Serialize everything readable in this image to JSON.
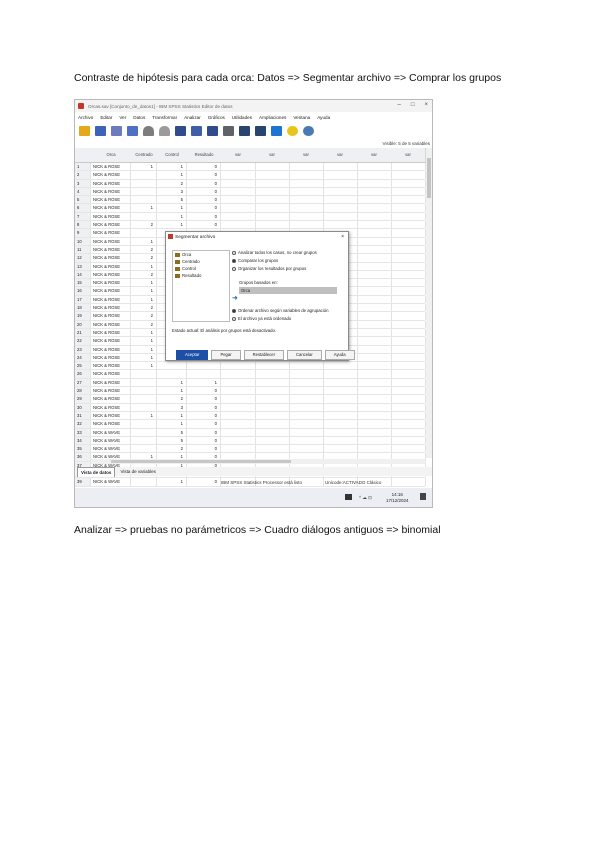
{
  "captions": {
    "top": "Contraste de hipótesis para cada orca: Datos => Segmentar archivo => Comprar los grupos",
    "bottom": "Analizar => pruebas no parámetricos => Cuadro diálogos antiguos => binomial"
  },
  "screenshot": {
    "window_title": "Orcas.sav [Conjunto_de_datos1] - IBM SPSS Statistics Editor de datos",
    "window_controls": [
      "–",
      "□",
      "×"
    ],
    "menu": [
      "Archivo",
      "Editar",
      "Ver",
      "Datos",
      "Transformar",
      "Analizar",
      "Gráficos",
      "Utilidades",
      "Ampliaciones",
      "Ventana",
      "Ayuda"
    ],
    "toolbar_icons": [
      "folder-icon",
      "save-icon",
      "print-icon",
      "dialog-recall-icon",
      "undo-icon",
      "redo-icon",
      "goto-variable-icon",
      "variables-icon",
      "find-icon",
      "split-file-icon",
      "select-cases-icon",
      "value-labels-icon",
      "extension-icon",
      "search-icon"
    ],
    "visible_label": "Visible: 5 de 5 variables",
    "columns": [
      "Orca",
      "Centrado",
      "Control",
      "Resultado",
      "var",
      "var",
      "var",
      "var",
      "var",
      "var"
    ],
    "rows": [
      {
        "n": "1",
        "orca": "NICK & ROSE",
        "cent": "1",
        "ctr": "1",
        "res": "0"
      },
      {
        "n": "2",
        "orca": "NICK & ROSE",
        "cent": "",
        "ctr": "1",
        "res": "0"
      },
      {
        "n": "3",
        "orca": "NICK & ROSE",
        "cent": "",
        "ctr": "2",
        "res": "0"
      },
      {
        "n": "4",
        "orca": "NICK & ROSE",
        "cent": "",
        "ctr": "3",
        "res": "0"
      },
      {
        "n": "5",
        "orca": "NICK & ROSE",
        "cent": "",
        "ctr": "5",
        "res": "0"
      },
      {
        "n": "6",
        "orca": "NICK & ROSE",
        "cent": "1",
        "ctr": "1",
        "res": "0"
      },
      {
        "n": "7",
        "orca": "NICK & ROSE",
        "cent": "",
        "ctr": "1",
        "res": "0"
      },
      {
        "n": "8",
        "orca": "NICK & ROSE",
        "cent": "2",
        "ctr": "1",
        "res": "0"
      },
      {
        "n": "9",
        "orca": "NICK & ROSE",
        "cent": "",
        "ctr": "1",
        "res": "0"
      },
      {
        "n": "10",
        "orca": "NICK & ROSE",
        "cent": "1",
        "ctr": "",
        "res": ""
      },
      {
        "n": "11",
        "orca": "NICK & ROSE",
        "cent": "2",
        "ctr": "",
        "res": ""
      },
      {
        "n": "12",
        "orca": "NICK & ROSE",
        "cent": "2",
        "ctr": "",
        "res": ""
      },
      {
        "n": "13",
        "orca": "NICK & ROSE",
        "cent": "1",
        "ctr": "",
        "res": ""
      },
      {
        "n": "14",
        "orca": "NICK & ROSE",
        "cent": "2",
        "ctr": "",
        "res": ""
      },
      {
        "n": "15",
        "orca": "NICK & ROSE",
        "cent": "1",
        "ctr": "",
        "res": ""
      },
      {
        "n": "16",
        "orca": "NICK & ROSE",
        "cent": "1",
        "ctr": "",
        "res": ""
      },
      {
        "n": "17",
        "orca": "NICK & ROSE",
        "cent": "1",
        "ctr": "",
        "res": ""
      },
      {
        "n": "18",
        "orca": "NICK & ROSE",
        "cent": "2",
        "ctr": "",
        "res": ""
      },
      {
        "n": "19",
        "orca": "NICK & ROSE",
        "cent": "2",
        "ctr": "",
        "res": ""
      },
      {
        "n": "20",
        "orca": "NICK & ROSE",
        "cent": "2",
        "ctr": "",
        "res": ""
      },
      {
        "n": "21",
        "orca": "NICK & ROSE",
        "cent": "1",
        "ctr": "",
        "res": ""
      },
      {
        "n": "22",
        "orca": "NICK & ROSE",
        "cent": "1",
        "ctr": "",
        "res": ""
      },
      {
        "n": "23",
        "orca": "NICK & ROSE",
        "cent": "1",
        "ctr": "",
        "res": ""
      },
      {
        "n": "24",
        "orca": "NICK & ROSE",
        "cent": "1",
        "ctr": "",
        "res": ""
      },
      {
        "n": "25",
        "orca": "NICK & ROSE",
        "cent": "1",
        "ctr": "",
        "res": ""
      },
      {
        "n": "26",
        "orca": "NICK & ROSE",
        "cent": "",
        "ctr": "",
        "res": ""
      },
      {
        "n": "27",
        "orca": "NICK & ROSE",
        "cent": "",
        "ctr": "1",
        "res": "1"
      },
      {
        "n": "28",
        "orca": "NICK & ROSE",
        "cent": "",
        "ctr": "1",
        "res": "0"
      },
      {
        "n": "29",
        "orca": "NICK & ROSE",
        "cent": "",
        "ctr": "2",
        "res": "0"
      },
      {
        "n": "30",
        "orca": "NICK & ROSE",
        "cent": "",
        "ctr": "3",
        "res": "0"
      },
      {
        "n": "31",
        "orca": "NICK & ROSE",
        "cent": "1",
        "ctr": "1",
        "res": "0"
      },
      {
        "n": "32",
        "orca": "NICK & ROSE",
        "cent": "",
        "ctr": "1",
        "res": "0"
      },
      {
        "n": "33",
        "orca": "NICK & WAVE",
        "cent": "",
        "ctr": "5",
        "res": "0"
      },
      {
        "n": "34",
        "orca": "NICK & WAVE",
        "cent": "",
        "ctr": "5",
        "res": "0"
      },
      {
        "n": "35",
        "orca": "NICK & WAVE",
        "cent": "",
        "ctr": "2",
        "res": "0"
      },
      {
        "n": "36",
        "orca": "NICK & WAVE",
        "cent": "1",
        "ctr": "1",
        "res": "0"
      },
      {
        "n": "37",
        "orca": "NICK & WAVE",
        "cent": "",
        "ctr": "1",
        "res": "0"
      },
      {
        "n": "38",
        "orca": "NICK & WAVE",
        "cent": "",
        "ctr": "C",
        "res": "0"
      },
      {
        "n": "39",
        "orca": "NICK & WAVE",
        "cent": "",
        "ctr": "1",
        "res": "0"
      }
    ],
    "tabs": [
      "Vista de datos",
      "Vista de variables"
    ],
    "status": {
      "processor": "IBM SPSS Statistics Processor está listo",
      "encoding": "Unicode:ACTIVADO  Clásico"
    },
    "taskbar": {
      "tray": "^  ☁  ⊡",
      "time": "14:16",
      "date": "17/12/2024"
    },
    "dialog": {
      "title": "Segmentar archivo",
      "close": "×",
      "variables": [
        "Orca",
        "Centrado",
        "Control",
        "Resultado"
      ],
      "options": [
        {
          "label": "Analizar todos los casos, no crear grupos",
          "selected": false
        },
        {
          "label": "Comparar los grupos",
          "selected": true
        },
        {
          "label": "Organizar los resultados por grupos",
          "selected": false
        }
      ],
      "groups_label": "Grupos basados en:",
      "group_variable": "Orca",
      "arrow": "➜",
      "sort_options": [
        {
          "label": "Ordenar archivo según variables de agrupación",
          "selected": true
        },
        {
          "label": "El archivo ya está ordenado",
          "selected": false
        }
      ],
      "estado": "Estado actual: El análisis por grupos está desactivado.",
      "buttons": [
        "Aceptar",
        "Pegar",
        "Restablecer",
        "Cancelar",
        "Ayuda"
      ]
    }
  }
}
